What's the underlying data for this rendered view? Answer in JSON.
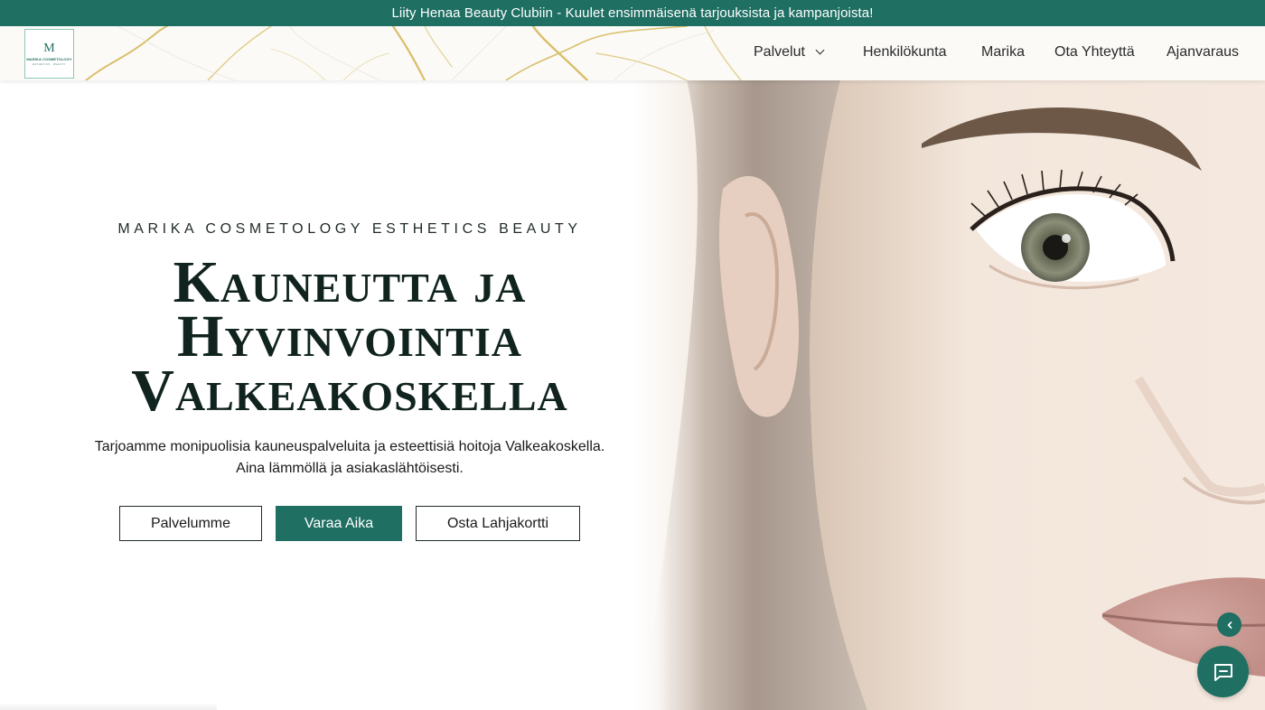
{
  "announcement": {
    "text": "Liity Henaa Beauty Clubiin - Kuulet ensimmäisenä tarjouksista ja kampanjoista!"
  },
  "logo": {
    "letter": "M",
    "line1": "MARIKA COSMETOLOGY",
    "line2": "ESTHETICS · BEAUTY"
  },
  "nav": {
    "items": [
      {
        "label": "Palvelut",
        "has_dropdown": true
      },
      {
        "label": "Henkilökunta"
      },
      {
        "label": "Marika"
      },
      {
        "label": "Ota Yhteyttä"
      },
      {
        "label": "Ajanvaraus"
      }
    ]
  },
  "hero": {
    "eyebrow": "MARIKA COSMETOLOGY ESTHETICS BEAUTY",
    "title_line1": "Kauneutta ja",
    "title_line2": "Hyvinvointia",
    "title_line3": "Valkeakoskella",
    "subtitle_line1": "Tarjoamme monipuolisia kauneuspalveluita ja esteettisiä hoitoja Valkeakoskella.",
    "subtitle_line2": "Aina lämmöllä ja asiakaslähtöisesti.",
    "buttons": {
      "services": "Palvelumme",
      "book": "Varaa Aika",
      "giftcard": "Osta Lahjakortti"
    }
  },
  "colors": {
    "accent": "#1f6f63",
    "text": "#10231f",
    "gold": "#d9bf6a"
  },
  "icons": {
    "chat": "chat-bubble-icon",
    "collapse": "chevron-left-icon",
    "dropdown": "chevron-down-icon"
  }
}
